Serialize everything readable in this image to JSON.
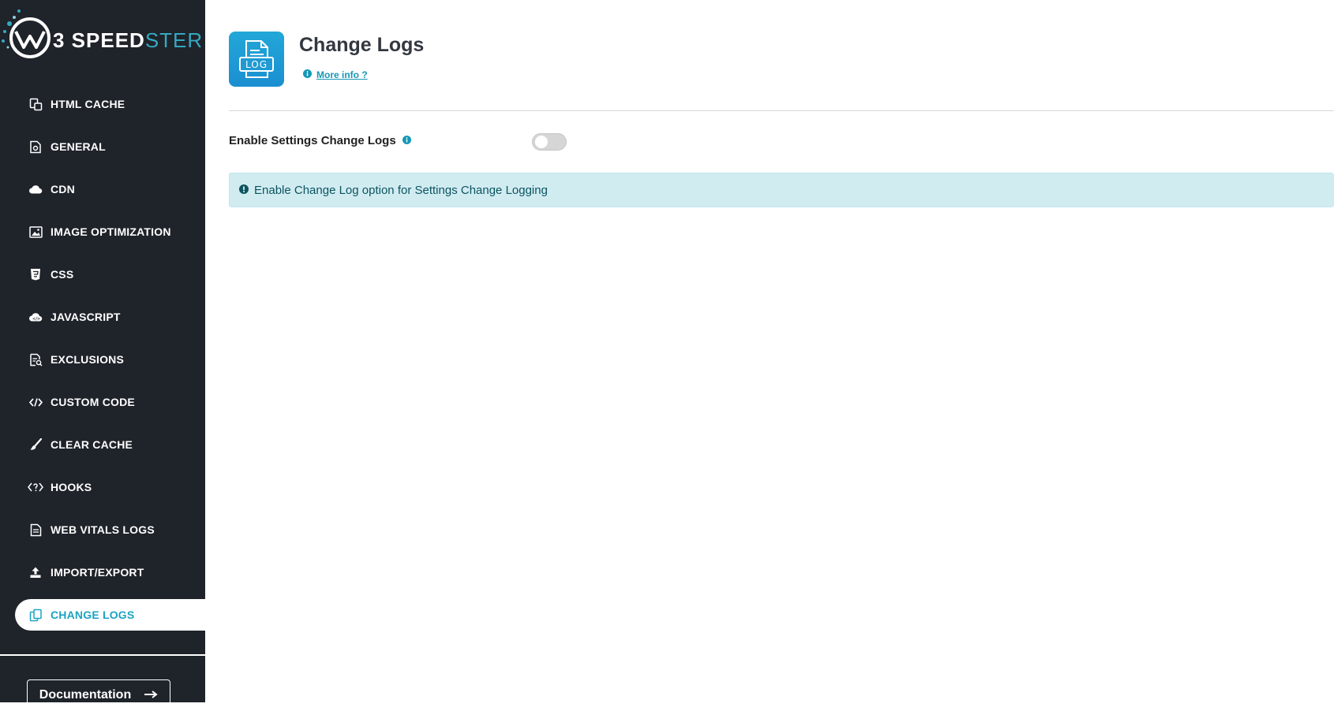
{
  "brand": {
    "name_prefix": "3 SPEED",
    "name_suffix": "STER"
  },
  "sidebar": {
    "items": [
      {
        "label": "HTML CACHE",
        "icon": "html-cache-icon"
      },
      {
        "label": "GENERAL",
        "icon": "general-icon"
      },
      {
        "label": "CDN",
        "icon": "cloud-icon"
      },
      {
        "label": "IMAGE OPTIMIZATION",
        "icon": "image-icon"
      },
      {
        "label": "CSS",
        "icon": "css-icon"
      },
      {
        "label": "JAVASCRIPT",
        "icon": "javascript-icon"
      },
      {
        "label": "EXCLUSIONS",
        "icon": "exclusions-icon"
      },
      {
        "label": "CUSTOM CODE",
        "icon": "code-icon"
      },
      {
        "label": "CLEAR CACHE",
        "icon": "brush-icon"
      },
      {
        "label": "HOOKS",
        "icon": "hooks-icon"
      },
      {
        "label": "WEB VITALS LOGS",
        "icon": "document-icon"
      },
      {
        "label": "IMPORT/EXPORT",
        "icon": "upload-icon"
      },
      {
        "label": "CHANGE LOGS",
        "icon": "change-logs-icon",
        "active": true
      }
    ],
    "documentation_label": "Documentation"
  },
  "main": {
    "icon_text": "LOG",
    "title": "Change Logs",
    "more_info": "More info ?",
    "setting_label": "Enable Settings Change Logs",
    "toggle_on": false,
    "alert_text": "Enable Change Log option for Settings Change Logging"
  },
  "colors": {
    "sidebar_bg": "#1f232a",
    "accent": "#1ca3c1",
    "alert_bg": "#d1ecf1",
    "alert_text": "#0c5460"
  }
}
